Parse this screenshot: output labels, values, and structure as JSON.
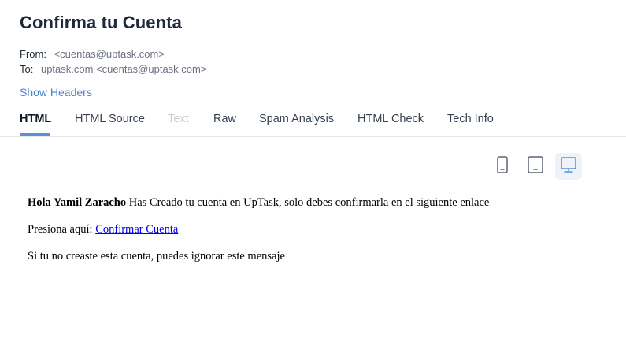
{
  "email": {
    "subject": "Confirma tu Cuenta",
    "from_label": "From:",
    "from_value": "<cuentas@uptask.com>",
    "to_label": "To:",
    "to_value": "uptask.com <cuentas@uptask.com>",
    "show_headers": "Show Headers"
  },
  "tabs": [
    {
      "label": "HTML",
      "active": true
    },
    {
      "label": "HTML Source"
    },
    {
      "label": "Text",
      "disabled": true
    },
    {
      "label": "Raw"
    },
    {
      "label": "Spam Analysis"
    },
    {
      "label": "HTML Check"
    },
    {
      "label": "Tech Info"
    }
  ],
  "device_toggle": {
    "options": [
      "mobile-icon",
      "tablet-icon",
      "desktop-icon"
    ],
    "selected": "desktop-icon"
  },
  "colors": {
    "accent": "#5a8fd0",
    "link": "#4a86c5",
    "icon": "#5b6472"
  },
  "body": {
    "greeting_bold": "Hola Yamil Zaracho",
    "greeting_rest": " Has Creado tu cuenta en UpTask, solo debes confirmarla en el siguiente enlace",
    "press_text": "Presiona aquí: ",
    "confirm_link": "Confirmar Cuenta",
    "ignore_text": "Si tu no creaste esta cuenta, puedes ignorar este mensaje"
  }
}
